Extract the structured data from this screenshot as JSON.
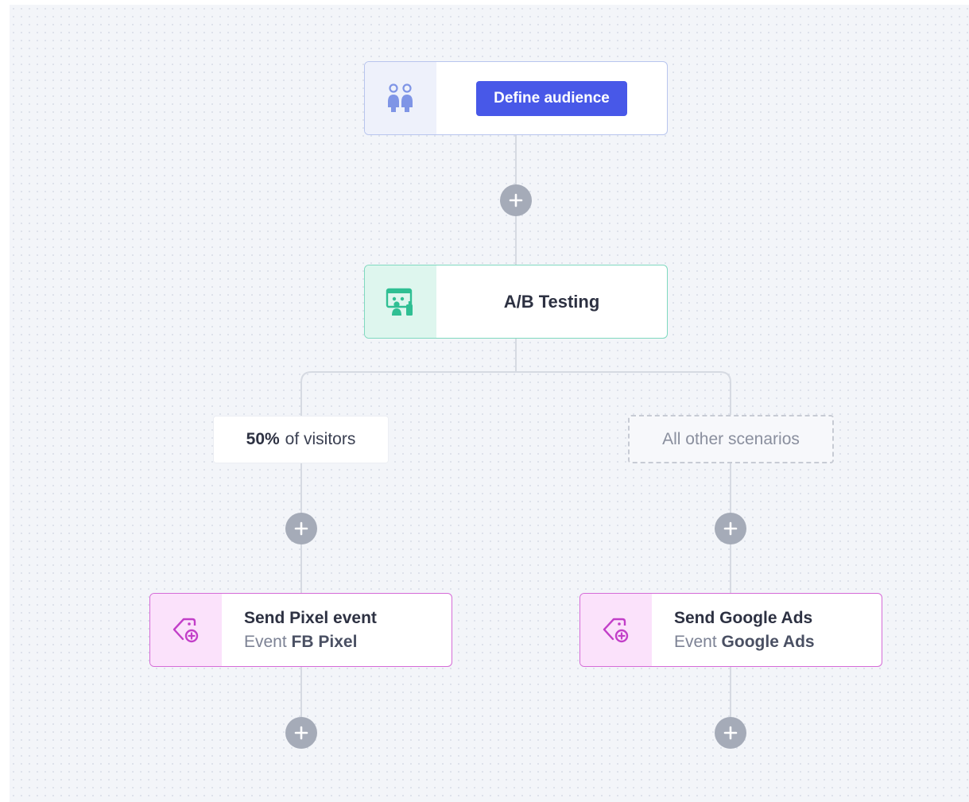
{
  "flow": {
    "audience": {
      "icon": "users-icon",
      "button_label": "Define audience",
      "accent": "#4858e8"
    },
    "ab_testing": {
      "icon": "ab-test-icon",
      "title": "A/B Testing",
      "accent": "#7fd9bf"
    },
    "branches": {
      "left": {
        "percent": "50%",
        "text": "of visitors"
      },
      "right": {
        "text": "All other scenarios"
      }
    },
    "actions": {
      "pixel": {
        "icon": "tag-add-icon",
        "title": "Send Pixel event",
        "event_prefix": "Event",
        "event_name": "FB Pixel"
      },
      "google_ads": {
        "icon": "tag-add-icon",
        "title": "Send Google Ads",
        "event_prefix": "Event",
        "event_name": "Google Ads"
      }
    },
    "add_step_icon": "plus-icon",
    "colors": {
      "connector": "#d6dae2",
      "add_button": "#a5abb8",
      "action_border": "#d56bd7"
    }
  }
}
